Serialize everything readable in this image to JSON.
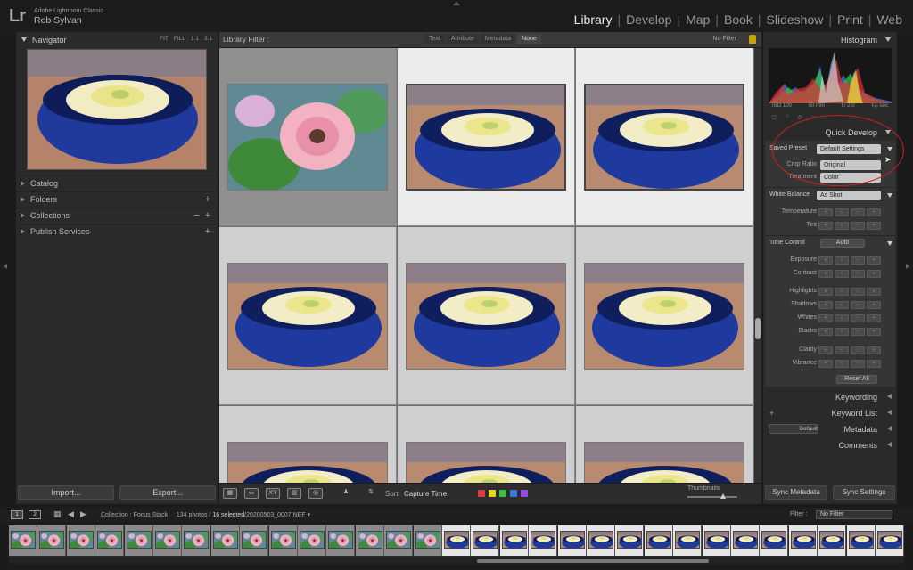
{
  "identity": {
    "logo": "Lr",
    "app_name": "Adobe Lightroom Classic",
    "user": "Rob Sylvan"
  },
  "modules": [
    {
      "label": "Library",
      "active": true
    },
    {
      "label": "Develop"
    },
    {
      "label": "Map"
    },
    {
      "label": "Book"
    },
    {
      "label": "Slideshow"
    },
    {
      "label": "Print"
    },
    {
      "label": "Web"
    }
  ],
  "navigator": {
    "title": "Navigator",
    "zoom": [
      "FIT",
      "FILL",
      "1:1",
      "3:1"
    ]
  },
  "left_sections": [
    {
      "label": "Catalog"
    },
    {
      "label": "Folders"
    },
    {
      "label": "Collections"
    },
    {
      "label": "Publish Services"
    }
  ],
  "left_bottom": {
    "import": "Import...",
    "export": "Export..."
  },
  "library_filter": {
    "label": "Library Filter :",
    "tabs": [
      "Text",
      "Attribute",
      "Metadata",
      "None"
    ],
    "preset": "No Filter"
  },
  "toolbar": {
    "sort_label": "Sort:",
    "sort_value": "Capture Time",
    "thumbnails_label": "Thumbnails",
    "colors": [
      "#e23a3a",
      "#e5d02a",
      "#3fbf3f",
      "#3a78e2",
      "#9a4ae2"
    ],
    "thumbnail_size": 0.7
  },
  "right_panel": {
    "histogram": "Histogram",
    "exif": {
      "iso": "ISO 100",
      "focal": "50 mm",
      "aperture": "f / 2.0",
      "shutter": "¹⁄₄₅ sec"
    },
    "quick_develop": "Quick Develop",
    "saved_preset_label": "Saved Preset",
    "saved_preset": "Default Settings",
    "crop_ratio_label": "Crop Ratio",
    "crop_ratio": "Original",
    "treatment_label": "Treatment",
    "treatment": "Color",
    "white_balance_label": "White Balance",
    "white_balance": "As Shot",
    "wb_rows": [
      "Temperature",
      "Tint"
    ],
    "tone_control_label": "Tone Control",
    "auto": "Auto",
    "tone_rows": [
      "Exposure",
      "Contrast",
      "Highlights",
      "Shadows",
      "Whites",
      "Blacks",
      "Clarity",
      "Vibrance"
    ],
    "reset": "Reset All",
    "keywording": "Keywording",
    "keyword_list": "Keyword List",
    "metadata": "Metadata",
    "metadata_preset": "Default",
    "comments": "Comments"
  },
  "right_bottom": {
    "sync_metadata": "Sync Metadata",
    "sync_settings": "Sync Settings"
  },
  "filmstrip": {
    "monitor1": "1",
    "monitor2": "2",
    "collection": "Collection : Focus Stack",
    "count": "134 photos /",
    "selected": "16 selected",
    "filename": "/20200503_0007.NEF",
    "filter_label": "Filter :",
    "filter_value": "No Filter",
    "unselected_count": 15,
    "selected_count": 16
  }
}
